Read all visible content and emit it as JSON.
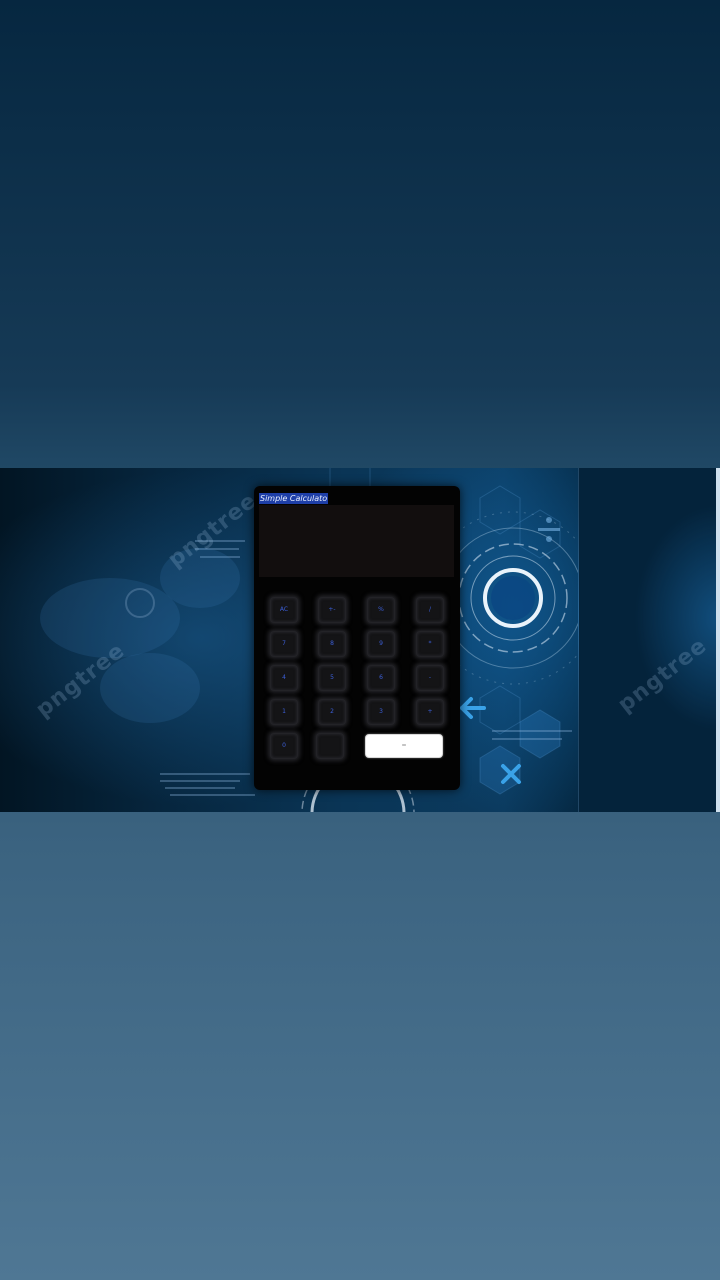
{
  "app": {
    "title": "Simple Calculato",
    "display_value": ""
  },
  "watermark": {
    "text": "pngtree"
  },
  "keypad": {
    "row1": [
      "AC",
      "+-",
      "%",
      "/"
    ],
    "row2": [
      "7",
      "8",
      "9",
      "*"
    ],
    "row3": [
      "4",
      "5",
      "6",
      "-"
    ],
    "row4": [
      "1",
      "2",
      "3",
      "+"
    ],
    "row5": [
      "0",
      "",
      "="
    ]
  },
  "colors": {
    "title_highlight": "#1e3fa8",
    "key_text": "#3c5fd8",
    "calculator_body": "#030303",
    "display_bg": "#120e0e"
  }
}
